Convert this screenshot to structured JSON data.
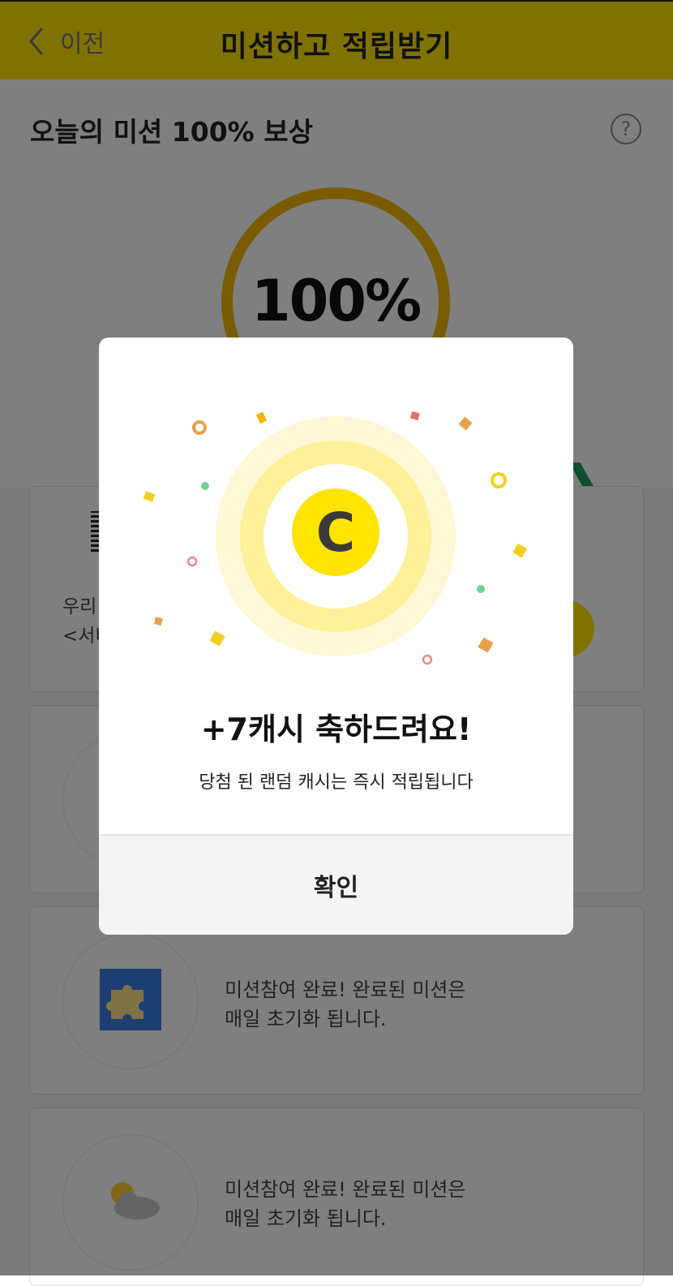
{
  "header": {
    "back_label": "이전",
    "title": "미션하고 적립받기"
  },
  "summary": {
    "title": "오늘의 미션 100% 보상",
    "help_symbol": "?",
    "progress_text": "100%",
    "progress_fraction": 1.0
  },
  "missions": {
    "card1_text": "우리\n<서비",
    "card3_text": "미션참여 완료!  완료된 미션은\n매일 초기화 됩니다.",
    "card4_text": "미션참여 완료!  완료된 미션은\n매일 초기화 됩니다."
  },
  "dialog": {
    "coin_letter": "C",
    "title": "+7캐시 축하드려요!",
    "subtitle": "당첨 된 랜덤 캐시는 즉시 적립됩니다",
    "confirm_label": "확인"
  },
  "colors": {
    "brand_yellow": "#ffe400",
    "ring_gold": "#f2b700",
    "green_accent": "#1a9e5a",
    "coin_dark": "#3a3a3a"
  }
}
